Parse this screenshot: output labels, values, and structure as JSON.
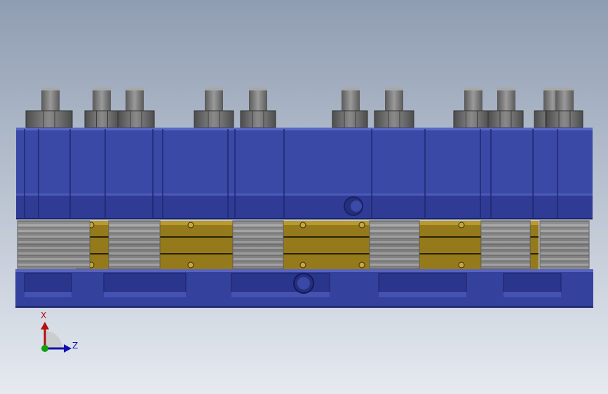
{
  "viewport": {
    "background_top": "#8f9db2",
    "background_bottom": "#e6eaf0"
  },
  "model": {
    "plate_color": "#3c4aa8",
    "plate_dark": "#262f80",
    "plate_light": "#5864c0",
    "brass_color": "#9a7d1e",
    "spring_color": "#8a8a8a",
    "nut_color": "#6e6e6e",
    "bolt_color": "#7a7a7a"
  },
  "triad": {
    "x_label": "X",
    "z_label": "Z",
    "x_color": "#b01010",
    "z_color": "#1010b0",
    "origin_color": "#10a010"
  }
}
